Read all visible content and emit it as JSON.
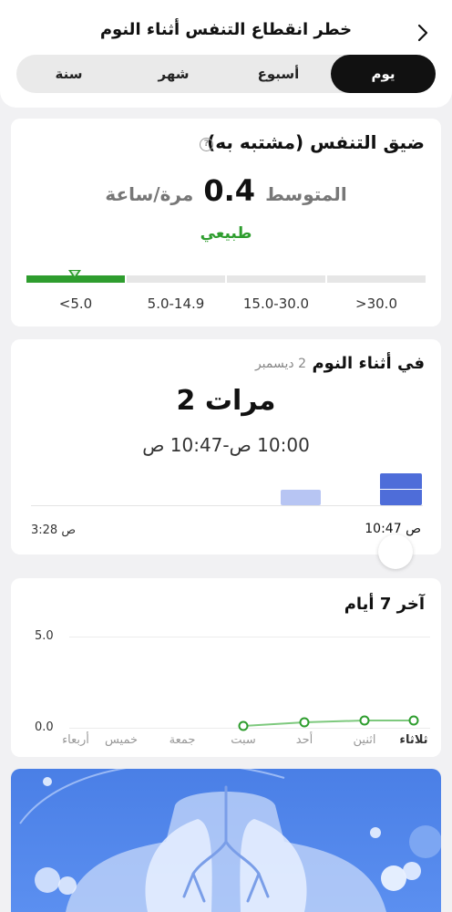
{
  "header": {
    "title": "خطر انقطاع التنفس أثناء النوم",
    "tabs": [
      {
        "label": "يوم",
        "active": true
      },
      {
        "label": "أسبوع",
        "active": false
      },
      {
        "label": "شهر",
        "active": false
      },
      {
        "label": "سنة",
        "active": false
      }
    ]
  },
  "breathing_card": {
    "title": "ضيق التنفس (مشتبه به)",
    "help_symbol": "?",
    "average_label": "المتوسط",
    "average_value": "0.4",
    "average_unit": "مرة/ساعة",
    "status": "طبيعي",
    "scale_labels": [
      "<5.0",
      "5.0-14.9",
      "15.0-30.0",
      ">30.0"
    ],
    "marker_value": 0.4,
    "status_color": "#2e9d2e"
  },
  "sleep_card": {
    "title": "في أثناء النوم",
    "date": "2 ديسمبر",
    "count": "2 مرات",
    "time_range": "10:00 ص-10:47 ص",
    "start_time": "3:28 ص",
    "end_time": "10:47 ص",
    "bar_colors": {
      "light": "#b7c5f3",
      "dark": "#4e6dd9"
    }
  },
  "week_card": {
    "title": "آخر 7 أيام",
    "y_max_label": "5.0",
    "y_min_label": "0.0",
    "days": [
      "ثلاثاء",
      "اثنين",
      "أحد",
      "سبت",
      "جمعة",
      "خميس",
      "أربعاء"
    ],
    "line_color": "#7ec97e"
  },
  "chart_data": {
    "type": "line",
    "x": [
      "ثلاثاء",
      "اثنين",
      "أحد",
      "سبت",
      "جمعة",
      "خميس",
      "أربعاء"
    ],
    "series": [
      {
        "values": [
          0.4,
          0.4,
          0.3,
          0.1,
          null,
          null,
          null
        ]
      }
    ],
    "ylim": [
      0,
      5.0
    ],
    "direction": "rtl"
  }
}
